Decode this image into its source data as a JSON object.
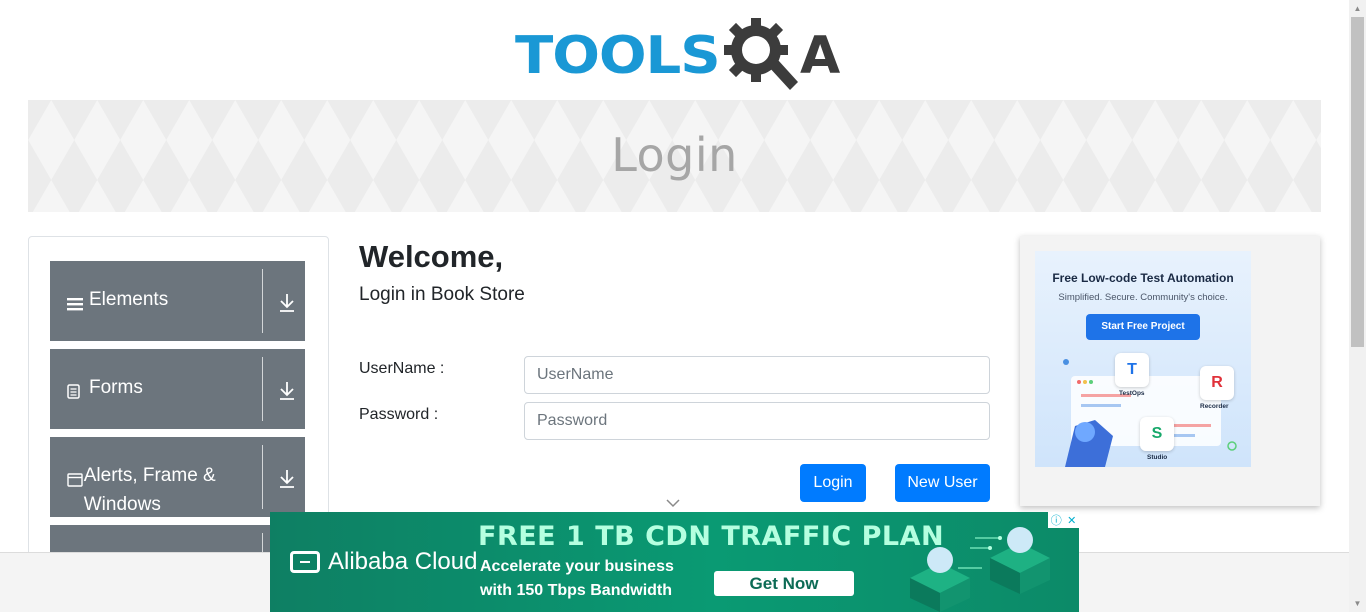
{
  "header": {
    "logo_text_left": "TOOLS",
    "logo_text_right": "A",
    "logo_blue": "#1a98d5",
    "logo_dark": "#3c3c3c"
  },
  "banner": {
    "title": "Login"
  },
  "sidebar": {
    "groups": [
      {
        "label": "Elements",
        "icon": "hamburger-icon"
      },
      {
        "label": "Forms",
        "icon": "document-icon"
      },
      {
        "label": "Alerts, Frame & Windows",
        "icon": "window-icon"
      },
      {
        "label": "",
        "icon": ""
      }
    ],
    "group_bg": "#6c757d"
  },
  "main": {
    "welcome": "Welcome,",
    "subtitle": "Login in Book Store",
    "username_label": "UserName :",
    "username_placeholder": "UserName",
    "username_value": "",
    "password_label": "Password :",
    "password_placeholder": "Password",
    "password_value": "",
    "login_button": "Login",
    "new_user_button": "New User",
    "accent": "#007bff"
  },
  "right_ad": {
    "headline": "Free Low-code Test Automation",
    "tagline": "Simplified. Secure. Community's choice.",
    "cta": "Start Free Project",
    "products": [
      "TestOps",
      "Recorder",
      "Studio"
    ]
  },
  "bottom_ad": {
    "brand": "Alibaba Cloud",
    "headline": "FREE 1 TB CDN TRAFFIC PLAN",
    "line1": "Accelerate your business",
    "line2": "with 150 Tbps Bandwidth",
    "cta": "Get Now",
    "adchoices_info": "ⓘ",
    "adchoices_close": "✕",
    "bg": "#0a9a73"
  }
}
